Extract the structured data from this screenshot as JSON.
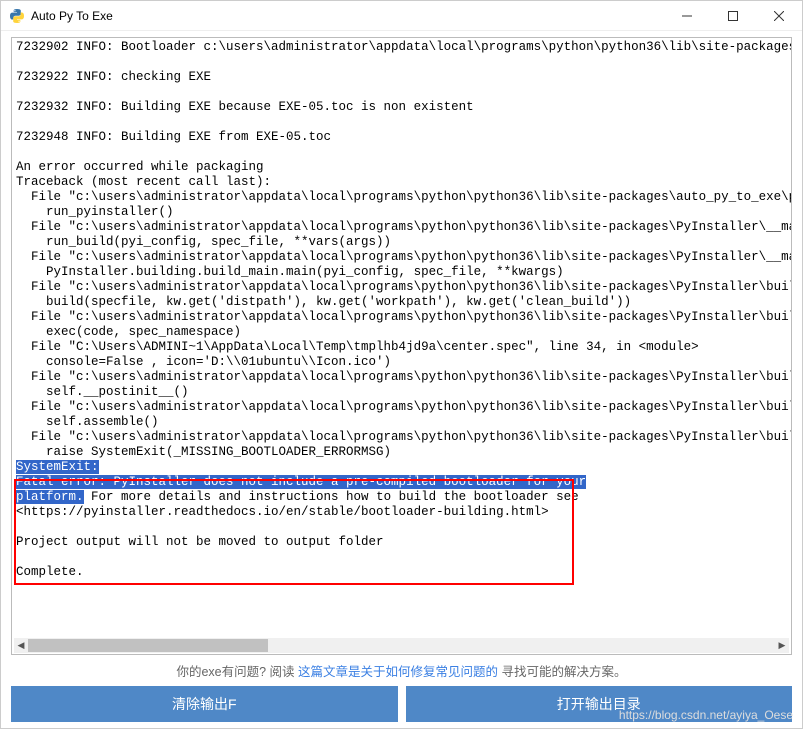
{
  "titlebar": {
    "title": "Auto Py To Exe",
    "minimize_icon": "min-icon",
    "maximize_icon": "max-icon",
    "close_icon": "close-icon"
  },
  "console": {
    "lines_top": "7232902 INFO: Bootloader c:\\users\\administrator\\appdata\\local\\programs\\python\\python36\\lib\\site-packages\\PyIns\n\n7232922 INFO: checking EXE\n\n7232932 INFO: Building EXE because EXE-05.toc is non existent\n\n7232948 INFO: Building EXE from EXE-05.toc\n\nAn error occurred while packaging\nTraceback (most recent call last):\n  File \"c:\\users\\administrator\\appdata\\local\\programs\\python\\python36\\lib\\site-packages\\auto_py_to_exe\\packagin\n    run_pyinstaller()\n  File \"c:\\users\\administrator\\appdata\\local\\programs\\python\\python36\\lib\\site-packages\\PyInstaller\\__main__.py\n    run_build(pyi_config, spec_file, **vars(args))\n  File \"c:\\users\\administrator\\appdata\\local\\programs\\python\\python36\\lib\\site-packages\\PyInstaller\\__main__.py\n    PyInstaller.building.build_main.main(pyi_config, spec_file, **kwargs)\n  File \"c:\\users\\administrator\\appdata\\local\\programs\\python\\python36\\lib\\site-packages\\PyInstaller\\building\\bu\n    build(specfile, kw.get('distpath'), kw.get('workpath'), kw.get('clean_build'))\n  File \"c:\\users\\administrator\\appdata\\local\\programs\\python\\python36\\lib\\site-packages\\PyInstaller\\building\\bu\n    exec(code, spec_namespace)\n  File \"C:\\Users\\ADMINI~1\\AppData\\Local\\Temp\\tmplhb4jd9a\\center.spec\", line 34, in <module>\n    console=False , icon='D:\\\\01ubuntu\\\\Icon.ico')\n  File \"c:\\users\\administrator\\appdata\\local\\programs\\python\\python36\\lib\\site-packages\\PyInstaller\\building\\ap\n    self.__postinit__()\n  File \"c:\\users\\administrator\\appdata\\local\\programs\\python\\python36\\lib\\site-packages\\PyInstaller\\building\\da\n    self.assemble()\n  File \"c:\\users\\administrator\\appdata\\local\\programs\\python\\python36\\lib\\site-packages\\PyInstaller\\building\\ap\n    raise SystemExit(_MISSING_BOOTLOADER_ERRORMSG)",
    "sel1": "SystemExit:",
    "sel2": "Fatal error: PyInstaller does not include a pre-compiled bootloader for your",
    "sel3": "platform.",
    "after_sel3": " For more details and instructions how to build the bootloader see",
    "line_url": "<https://pyinstaller.readthedocs.io/en/stable/bootloader-building.html>",
    "lines_bottom": "\n\nProject output will not be moved to output folder\n\nComplete.\n"
  },
  "help": {
    "prefix": "你的exe有问题? 阅读 ",
    "link": "这篇文章是关于如何修复常见问题的",
    "suffix": " 寻找可能的解决方案。"
  },
  "buttons": {
    "clear": "清除输出F",
    "open": "打开输出目录"
  },
  "watermark": "https://blog.csdn.net/ayiya_Oese"
}
